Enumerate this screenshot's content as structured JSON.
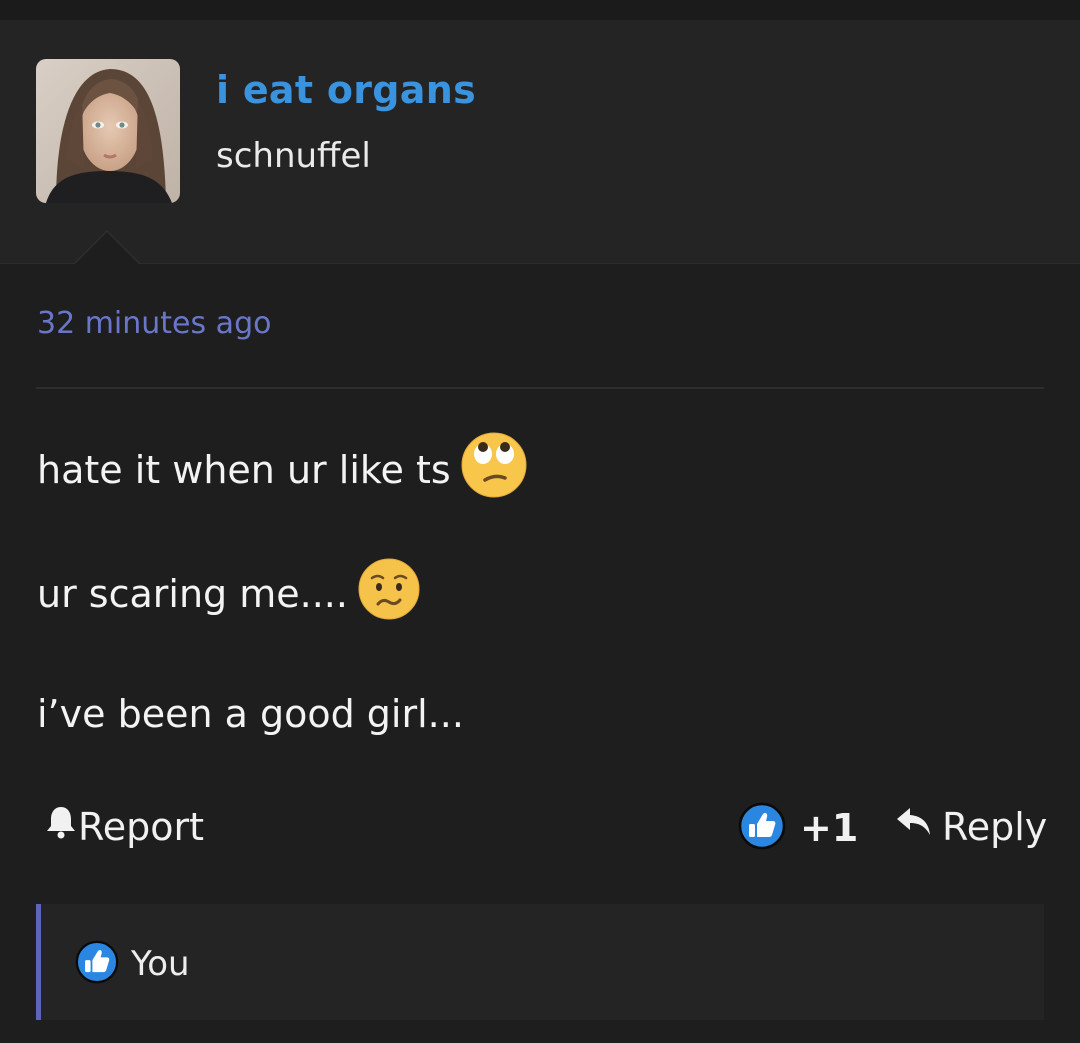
{
  "post": {
    "author_display": "i eat organs",
    "author_username": "schnuffel",
    "timestamp": "32 minutes ago",
    "lines": [
      "hate it when ur like ts",
      "ur scaring me....",
      "i’ve been a good girl..."
    ],
    "emojis": [
      "face-with-rolling-eyes",
      "worried-face"
    ]
  },
  "actions": {
    "report_label": "Report",
    "like_count": "+1",
    "reply_label": "Reply"
  },
  "liked_by": {
    "name": "You"
  },
  "colors": {
    "background": "#1e1e1f",
    "header": "#242425",
    "username_blue": "#3a93de",
    "timestamp_purple": "#6a77c9",
    "accent_bar": "#5b66b8",
    "like_icon_blue": "#2a86e0"
  }
}
